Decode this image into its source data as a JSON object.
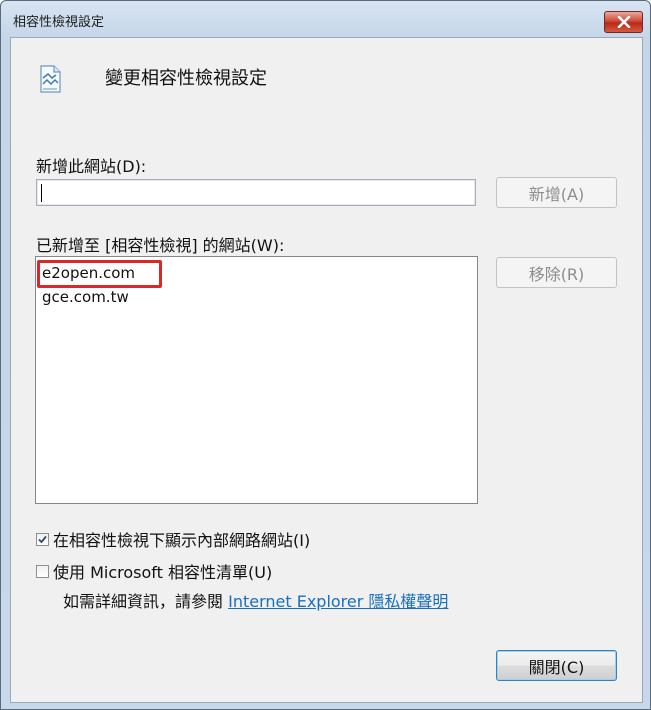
{
  "window": {
    "title": "相容性檢視設定",
    "close_icon": "close-icon"
  },
  "header": {
    "icon": "compat-view-icon",
    "text": "變更相容性檢視設定"
  },
  "add_site": {
    "label": "新增此網站(D):",
    "value": "",
    "button_label": "新增(A)"
  },
  "added_sites": {
    "label": "已新增至 [相容性檢視] 的網站(W):",
    "items": [
      "e2open.com",
      "gce.com.tw"
    ],
    "highlighted_item": "e2open.com",
    "remove_button_label": "移除(R)"
  },
  "options": {
    "intranet": {
      "label": "在相容性檢視下顯示內部網路網站(I)",
      "checked": true
    },
    "ms_list": {
      "label": "使用 Microsoft 相容性清單(U)",
      "checked": false
    }
  },
  "info": {
    "text": "如需詳細資訊，請參閱 ",
    "link_text": "Internet Explorer 隱私權聲明"
  },
  "footer": {
    "close_button_label": "關閉(C)"
  },
  "colors": {
    "highlight_border": "#d8282a",
    "link": "#1a6fbd",
    "close_button": "#c9402f"
  }
}
